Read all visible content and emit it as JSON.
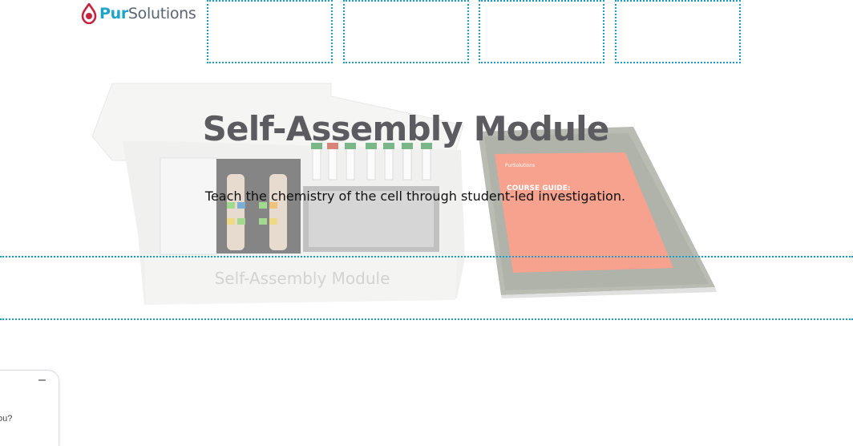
{
  "brand": {
    "name_part1": "Pur",
    "name_part2": "Solutions",
    "primary_color": "#1ea3c9",
    "accent_color": "#c8233e"
  },
  "nav": {
    "slots": [
      "",
      "",
      "",
      ""
    ]
  },
  "hero": {
    "title": "Self-Assembly Module",
    "subtitle": "Teach the chemistry of the cell through student-led investigation.",
    "image": {
      "box_label": "Self-Assembly Module",
      "guide_title": "COURSE GUIDE:",
      "guide_brand": "PurSolutions"
    }
  },
  "chat": {
    "minimize_label": "–",
    "partial_text": "ou?"
  }
}
